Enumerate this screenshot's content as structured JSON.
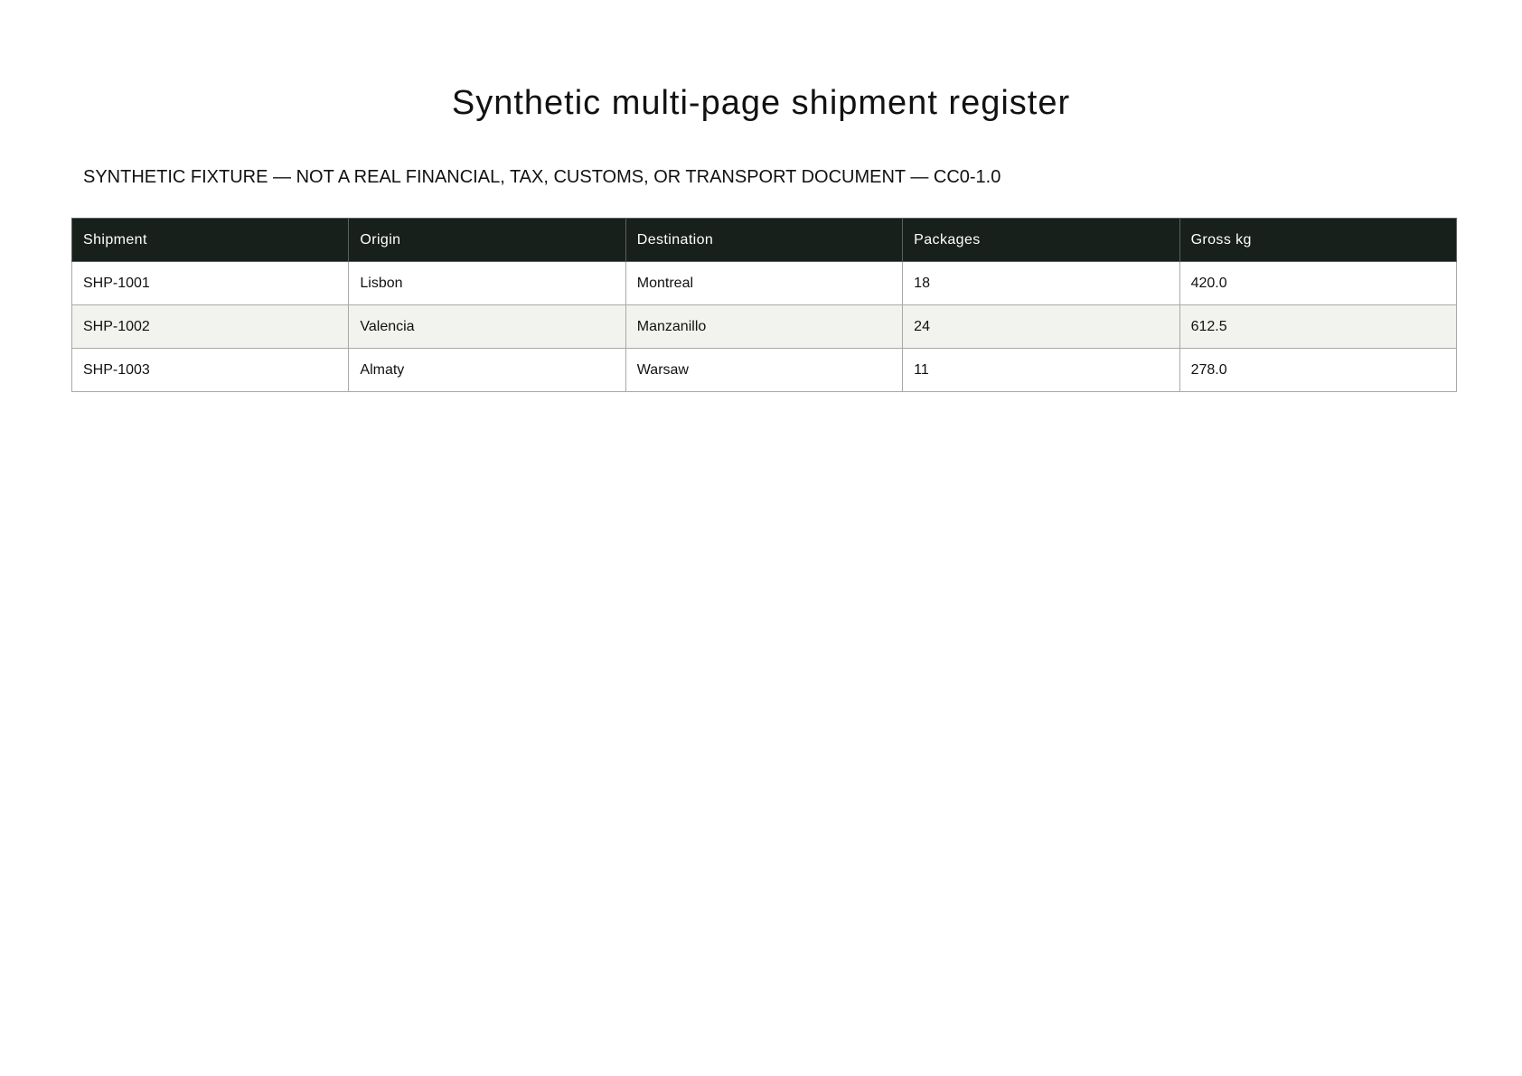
{
  "document": {
    "title": "Synthetic multi-page shipment register",
    "disclaimer": "SYNTHETIC FIXTURE — NOT A REAL FINANCIAL, TAX, CUSTOMS, OR TRANSPORT DOCUMENT — CC0-1.0"
  },
  "table": {
    "headers": [
      "Shipment",
      "Origin",
      "Destination",
      "Packages",
      "Gross kg"
    ],
    "rows": [
      [
        "SHP-1001",
        "Lisbon",
        "Montreal",
        "18",
        "420.0"
      ],
      [
        "SHP-1002",
        "Valencia",
        "Manzanillo",
        "24",
        "612.5"
      ],
      [
        "SHP-1003",
        "Almaty",
        "Warsaw",
        "11",
        "278.0"
      ]
    ]
  },
  "colors": {
    "header_background": "#18201c",
    "stripe_background": "#f2f2ee",
    "border": "#a9a9a9"
  }
}
